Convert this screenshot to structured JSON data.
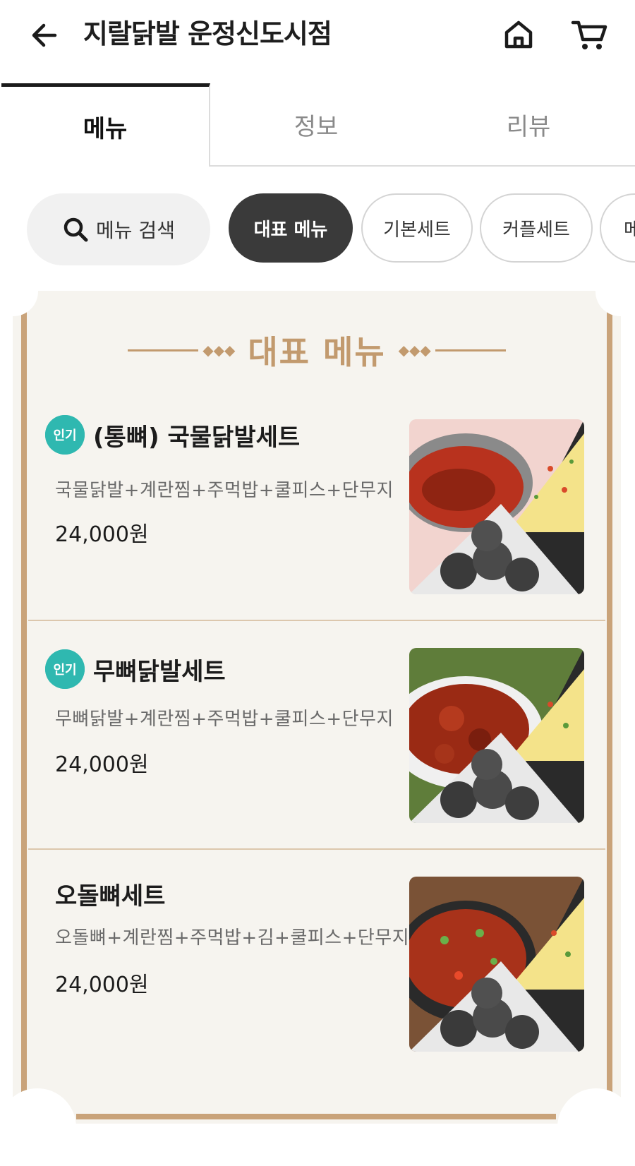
{
  "header": {
    "title": "지랄닭발 운정신도시점"
  },
  "tabs": [
    {
      "label": "메뉴"
    },
    {
      "label": "정보"
    },
    {
      "label": "리뷰"
    }
  ],
  "search": {
    "label": "메뉴 검색"
  },
  "categories": [
    {
      "label": "대표 메뉴",
      "active": true
    },
    {
      "label": "기본세트"
    },
    {
      "label": "커플세트"
    },
    {
      "label": "메"
    }
  ],
  "board": {
    "title": "대표 메뉴",
    "items": [
      {
        "badge": "인기",
        "name": "(통뼈) 국물닭발세트",
        "desc": "국물닭발+계란찜+주먹밥+쿨피스+단무지",
        "price": "24,000원"
      },
      {
        "badge": "인기",
        "name": "무뼈닭발세트",
        "desc": "무뼈닭발+계란찜+주먹밥+쿨피스+단무지",
        "price": "24,000원"
      },
      {
        "name": "오돌뼈세트",
        "desc": "오돌뼈+계란찜+주먹밥+김+쿨피스+단무지",
        "price": "24,000원"
      }
    ]
  },
  "colors": {
    "accent_brown": "#c29a6e",
    "badge_teal": "#2fb8b0",
    "active_chip": "#3a3a3a"
  }
}
